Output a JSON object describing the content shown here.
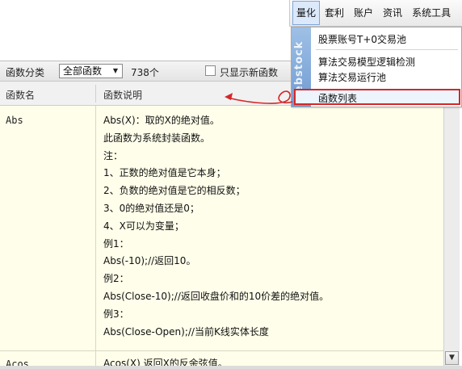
{
  "menu": {
    "items": [
      "量化",
      "套利",
      "账户",
      "资讯",
      "系统工具"
    ],
    "active_index": 0
  },
  "dropdown": {
    "stripe_text": "Webstock",
    "items": [
      "股票账号T+0交易池",
      "算法交易模型逻辑检测",
      "算法交易运行池",
      "函数列表"
    ],
    "highlighted_index": 3
  },
  "toolbar": {
    "category_label": "函数分类",
    "category_value": "全部函数",
    "count_text": "738个",
    "new_only_label": "只显示新函数",
    "new_only_checked": false
  },
  "table": {
    "headers": {
      "name": "函数名",
      "desc": "函数说明"
    },
    "rows": [
      {
        "name": "Abs",
        "desc": [
          "Abs(X)：取的X的绝对值。",
          "此函数为系统封装函数。",
          "注：",
          "1、正数的绝对值是它本身；",
          "2、负数的绝对值是它的相反数；",
          "3、0的绝对值还是0；",
          "4、X可以为变量；",
          "例1：",
          "Abs(-10);//返回10。",
          "例2：",
          "Abs(Close-10);//返回收盘价和的10价差的绝对值。",
          "例3：",
          "Abs(Close-Open);//当前K线实体长度"
        ]
      },
      {
        "name": "Acos",
        "desc": [
          "Acos(X) 返回X的反余弦值。"
        ]
      }
    ]
  },
  "colors": {
    "highlight_border": "#d62628",
    "table_background": "#fffeea",
    "menu_active": "#dbe9fb"
  },
  "icons": {
    "select_arrow": "▼",
    "scroll_down": "▼"
  }
}
